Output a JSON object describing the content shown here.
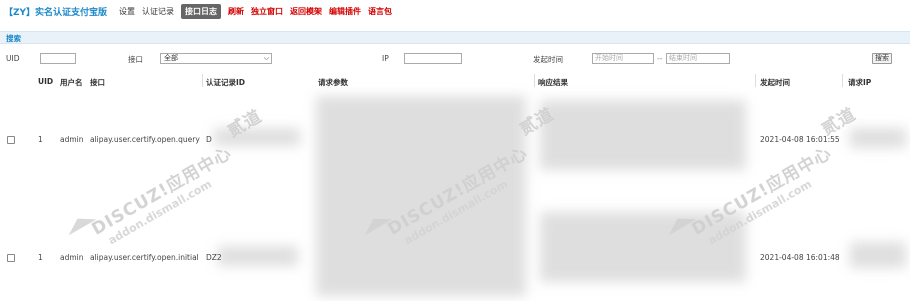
{
  "app": {
    "title": "【ZY】实名认证支付宝版"
  },
  "nav": [
    {
      "label": "设置",
      "style": "dark",
      "name": "nav-settings"
    },
    {
      "label": "认证记录",
      "style": "dark",
      "name": "nav-records"
    },
    {
      "label": "接口日志",
      "style": "active",
      "name": "nav-api-log"
    },
    {
      "label": "刷新",
      "style": "red",
      "name": "nav-refresh"
    },
    {
      "label": "独立窗口",
      "style": "red",
      "name": "nav-standalone"
    },
    {
      "label": "返回模架",
      "style": "red",
      "name": "nav-back"
    },
    {
      "label": "编辑插件",
      "style": "red",
      "name": "nav-edit-plugin"
    },
    {
      "label": "语言包",
      "style": "red",
      "name": "nav-language"
    }
  ],
  "search": {
    "heading": "搜索",
    "uid_label": "UID",
    "uid_value": "",
    "api_label": "接口",
    "api_selected": "全部",
    "ip_label": "IP",
    "ip_value": "",
    "time_label": "发起时间",
    "start_placeholder": "开始时间",
    "separator": "--",
    "end_placeholder": "结束时间",
    "button": "搜索"
  },
  "table": {
    "headers": [
      "UID",
      "用户名",
      "接口",
      "认证记录ID",
      "请求参数",
      "响应结果",
      "发起时间",
      "请求IP"
    ],
    "rows": [
      {
        "uid": "1",
        "username": "admin",
        "api": "alipay.user.certify.open.query",
        "record_id": "D",
        "time": "2021-04-08 16:01:55"
      },
      {
        "uid": "1",
        "username": "admin",
        "api": "alipay.user.certify.open.initial",
        "record_id": "DZ2",
        "time": "2021-04-08 16:01:48"
      }
    ]
  },
  "watermark": {
    "brand": "DISCUZ!应用中心",
    "domain": "addon.dismall.com",
    "suffix": "贰道"
  },
  "colors": {
    "accent": "#1e88c8",
    "nav_red": "#d40000",
    "active_bg": "#666666"
  }
}
